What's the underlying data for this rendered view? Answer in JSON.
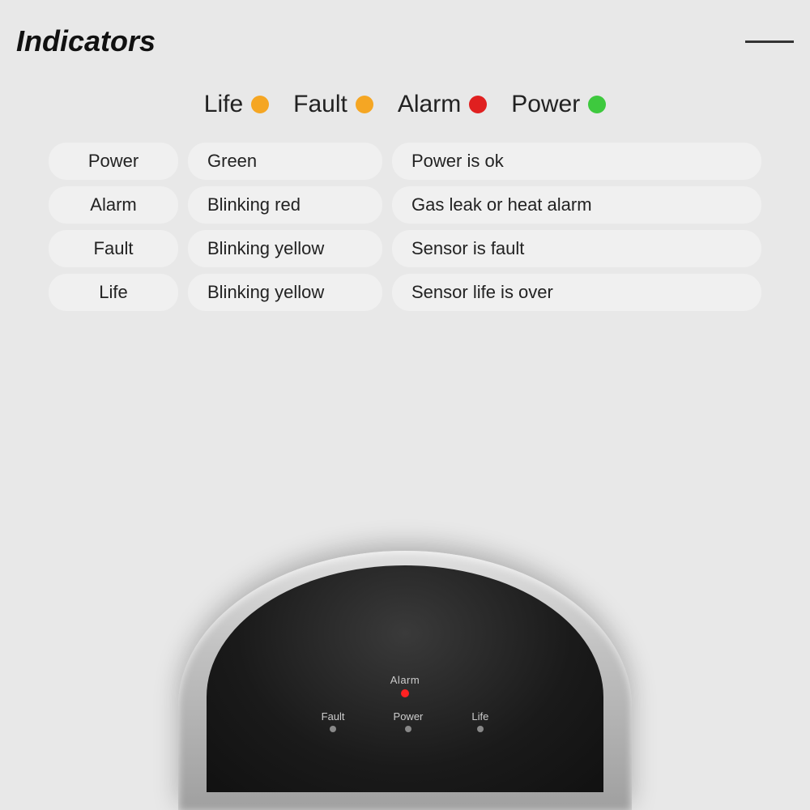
{
  "header": {
    "title": "Indicators",
    "line": true
  },
  "legend": [
    {
      "id": "life",
      "label": "Life",
      "color": "#f5a623"
    },
    {
      "id": "fault",
      "label": "Fault",
      "color": "#f5a623"
    },
    {
      "id": "alarm",
      "label": "Alarm",
      "color": "#e02020"
    },
    {
      "id": "power",
      "label": "Power",
      "color": "#3ec93e"
    }
  ],
  "table": {
    "rows": [
      {
        "col1": "Power",
        "col2": "Green",
        "col3": "Power is ok"
      },
      {
        "col1": "Alarm",
        "col2": "Blinking red",
        "col3": "Gas leak or heat alarm"
      },
      {
        "col1": "Fault",
        "col2": "Blinking yellow",
        "col3": "Sensor is fault"
      },
      {
        "col1": "Life",
        "col2": "Blinking yellow",
        "col3": "Sensor life is over"
      }
    ]
  },
  "device": {
    "alarm_label": "Alarm",
    "fault_label": "Fault",
    "power_label": "Power",
    "life_label": "Life"
  }
}
